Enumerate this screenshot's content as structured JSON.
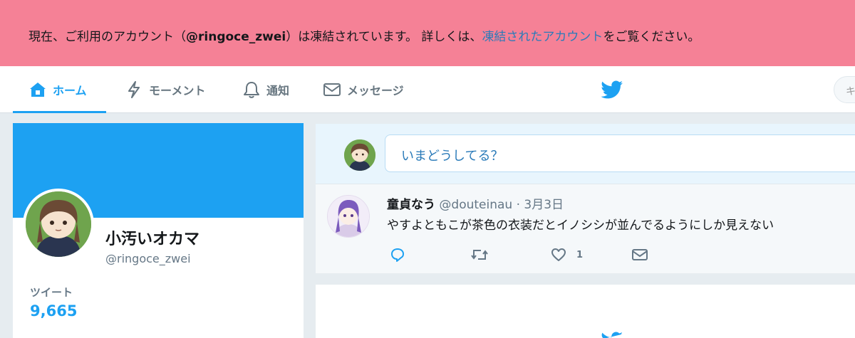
{
  "banner": {
    "prefix": "現在、ご利用のアカウント（",
    "account": "@ringoce_zwei",
    "middle": "）は凍結されています。 詳しくは、",
    "link": "凍結されたアカウント",
    "suffix": "をご覧ください。"
  },
  "nav": {
    "items": [
      {
        "label": "ホーム",
        "icon": "home-icon"
      },
      {
        "label": "モーメント",
        "icon": "lightning-icon"
      },
      {
        "label": "通知",
        "icon": "bell-icon"
      },
      {
        "label": "メッセージ",
        "icon": "envelope-icon"
      }
    ],
    "search_placeholder": "キ"
  },
  "profile": {
    "name": "小汚いオカマ",
    "handle": "@ringoce_zwei",
    "stat_label": "ツイート",
    "stat_value": "9,665"
  },
  "composer": {
    "placeholder": "いまどうしてる？"
  },
  "tweet": {
    "name": "童貞なう",
    "handle": "@douteinau",
    "date": "· 3月3日",
    "text": "やすよともこが茶色の衣装だとイノシシが並んでるようにしか見えない",
    "like_count": "1"
  },
  "colors": {
    "banner": "#f58196",
    "accent": "#1da1f2",
    "link": "#2b7bb9"
  }
}
